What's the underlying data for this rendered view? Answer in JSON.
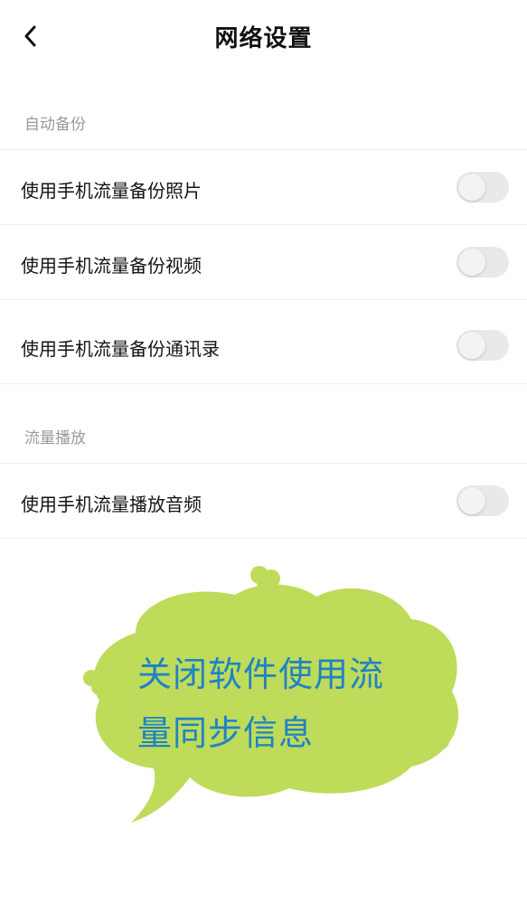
{
  "header": {
    "title": "网络设置",
    "back_icon": "chevron-left-icon"
  },
  "sections": [
    {
      "title": "自动备份",
      "rows": [
        {
          "label": "使用手机流量备份照片",
          "toggle_on": false
        },
        {
          "label": "使用手机流量备份视频",
          "toggle_on": false
        },
        {
          "label": "使用手机流量备份通讯录",
          "toggle_on": false
        }
      ]
    },
    {
      "title": "流量播放",
      "rows": [
        {
          "label": "使用手机流量播放音频",
          "toggle_on": false
        }
      ]
    }
  ],
  "annotation": {
    "line1": "关闭软件使用流",
    "line2": "量同步信息",
    "bubble_color": "#bedb5a",
    "text_color": "#1f83c4"
  },
  "colors": {
    "toggle_off_track": "#e9e9e9",
    "section_header_text": "#9a9a9a",
    "divider": "#ededed"
  }
}
